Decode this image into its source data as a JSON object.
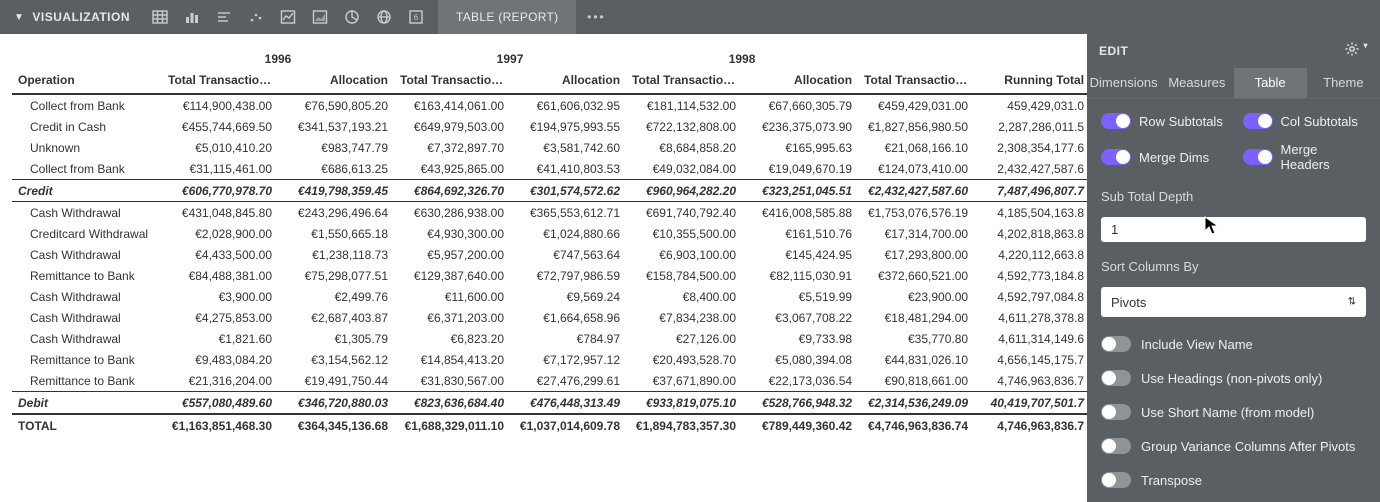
{
  "header": {
    "title": "VISUALIZATION",
    "tab": "TABLE (REPORT)"
  },
  "years": [
    "1996",
    "1997",
    "1998"
  ],
  "columns": {
    "operation": "Operation",
    "ttv": "Total Transaction Value",
    "alloc": "Allocation",
    "running": "Running Total"
  },
  "rows": [
    {
      "op": "Collect from Bank",
      "v": [
        "€114,900,438.00",
        "€76,590,805.20",
        "€163,414,061.00",
        "€61,606,032.95",
        "€181,114,532.00",
        "€67,660,305.79",
        "€459,429,031.00",
        "459,429,031.0"
      ]
    },
    {
      "op": "Credit in Cash",
      "v": [
        "€455,744,669.50",
        "€341,537,193.21",
        "€649,979,503.00",
        "€194,975,993.55",
        "€722,132,808.00",
        "€236,375,073.90",
        "€1,827,856,980.50",
        "2,287,286,011.5"
      ]
    },
    {
      "op": "Unknown",
      "v": [
        "€5,010,410.20",
        "€983,747.79",
        "€7,372,897.70",
        "€3,581,742.60",
        "€8,684,858.20",
        "€165,995.63",
        "€21,068,166.10",
        "2,308,354,177.6"
      ]
    },
    {
      "op": "Collect from Bank",
      "v": [
        "€31,115,461.00",
        "€686,613.25",
        "€43,925,865.00",
        "€41,410,803.53",
        "€49,032,084.00",
        "€19,049,670.19",
        "€124,073,410.00",
        "2,432,427,587.6"
      ]
    }
  ],
  "credit": {
    "label": "Credit",
    "v": [
      "€606,770,978.70",
      "€419,798,359.45",
      "€864,692,326.70",
      "€301,574,572.62",
      "€960,964,282.20",
      "€323,251,045.51",
      "€2,432,427,587.60",
      "7,487,496,807.7"
    ]
  },
  "rows2": [
    {
      "op": "Cash Withdrawal",
      "v": [
        "€431,048,845.80",
        "€243,296,496.64",
        "€630,286,938.00",
        "€365,553,612.71",
        "€691,740,792.40",
        "€416,008,585.88",
        "€1,753,076,576.19",
        "4,185,504,163.8"
      ]
    },
    {
      "op": "Creditcard Withdrawal",
      "v": [
        "€2,028,900.00",
        "€1,550,665.18",
        "€4,930,300.00",
        "€1,024,880.66",
        "€10,355,500.00",
        "€161,510.76",
        "€17,314,700.00",
        "4,202,818,863.8"
      ]
    },
    {
      "op": "Cash Withdrawal",
      "v": [
        "€4,433,500.00",
        "€1,238,118.73",
        "€5,957,200.00",
        "€747,563.64",
        "€6,903,100.00",
        "€145,424.95",
        "€17,293,800.00",
        "4,220,112,663.8"
      ]
    },
    {
      "op": "Remittance to Bank",
      "v": [
        "€84,488,381.00",
        "€75,298,077.51",
        "€129,387,640.00",
        "€72,797,986.59",
        "€158,784,500.00",
        "€82,115,030.91",
        "€372,660,521.00",
        "4,592,773,184.8"
      ]
    },
    {
      "op": "Cash Withdrawal",
      "v": [
        "€3,900.00",
        "€2,499.76",
        "€11,600.00",
        "€9,569.24",
        "€8,400.00",
        "€5,519.99",
        "€23,900.00",
        "4,592,797,084.8"
      ]
    },
    {
      "op": "Cash Withdrawal",
      "v": [
        "€4,275,853.00",
        "€2,687,403.87",
        "€6,371,203.00",
        "€1,664,658.96",
        "€7,834,238.00",
        "€3,067,708.22",
        "€18,481,294.00",
        "4,611,278,378.8"
      ]
    },
    {
      "op": "Cash Withdrawal",
      "v": [
        "€1,821.60",
        "€1,305.79",
        "€6,823.20",
        "€784.97",
        "€27,126.00",
        "€9,733.98",
        "€35,770.80",
        "4,611,314,149.6"
      ]
    },
    {
      "op": "Remittance to Bank",
      "v": [
        "€9,483,084.20",
        "€3,154,562.12",
        "€14,854,413.20",
        "€7,172,957.12",
        "€20,493,528.70",
        "€5,080,394.08",
        "€44,831,026.10",
        "4,656,145,175.7"
      ]
    },
    {
      "op": "Remittance to Bank",
      "v": [
        "€21,316,204.00",
        "€19,491,750.44",
        "€31,830,567.00",
        "€27,476,299.61",
        "€37,671,890.00",
        "€22,173,036.54",
        "€90,818,661.00",
        "4,746,963,836.7"
      ]
    }
  ],
  "debit": {
    "label": "Debit",
    "v": [
      "€557,080,489.60",
      "€346,720,880.03",
      "€823,636,684.40",
      "€476,448,313.49",
      "€933,819,075.10",
      "€528,766,948.32",
      "€2,314,536,249.09",
      "40,419,707,501.7"
    ]
  },
  "total": {
    "label": "TOTAL",
    "v": [
      "€1,163,851,468.30",
      "€364,345,136.68",
      "€1,688,329,011.10",
      "€1,037,014,609.78",
      "€1,894,783,357.30",
      "€789,449,360.42",
      "€4,746,963,836.74",
      "4,746,963,836.7"
    ]
  },
  "side": {
    "title": "EDIT",
    "tabs": [
      "Dimensions",
      "Measures",
      "Table",
      "Theme"
    ],
    "active_tab": 2,
    "toggles": {
      "row_subtotals": {
        "label": "Row Subtotals",
        "on": true
      },
      "col_subtotals": {
        "label": "Col Subtotals",
        "on": true
      },
      "merge_dims": {
        "label": "Merge Dims",
        "on": true
      },
      "merge_headers": {
        "label": "Merge Headers",
        "on": true
      }
    },
    "subtotal_depth": {
      "label": "Sub Total Depth",
      "value": "1"
    },
    "sort_columns": {
      "label": "Sort Columns By",
      "value": "Pivots"
    },
    "options": [
      {
        "label": "Include View Name",
        "on": false
      },
      {
        "label": "Use Headings (non-pivots only)",
        "on": false
      },
      {
        "label": "Use Short Name (from model)",
        "on": false
      },
      {
        "label": "Group Variance Columns After Pivots",
        "on": false
      },
      {
        "label": "Transpose",
        "on": false
      }
    ]
  }
}
